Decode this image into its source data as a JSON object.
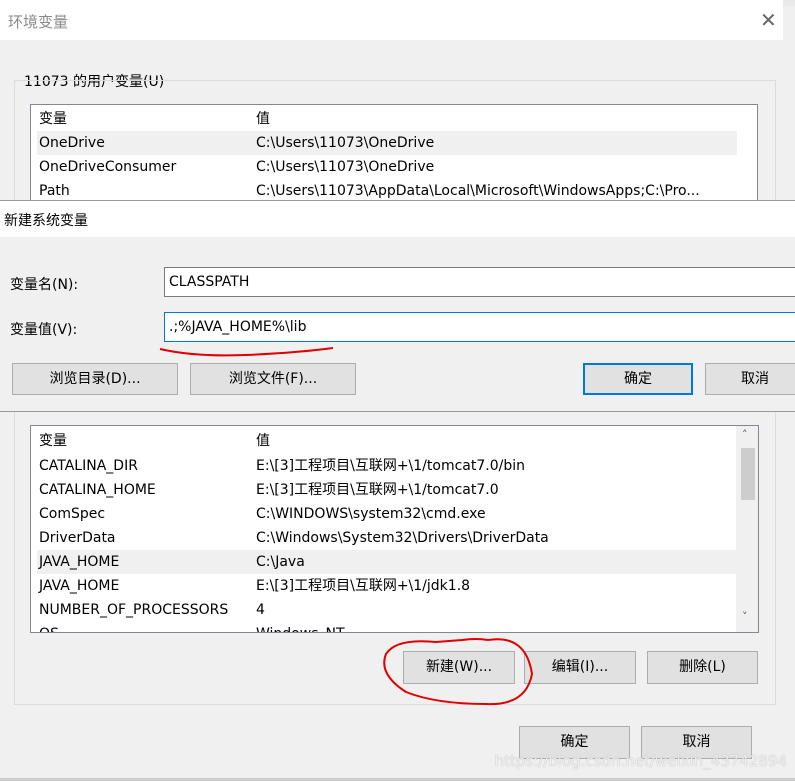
{
  "env_dialog": {
    "title": "环境变量",
    "close_icon": "close-icon",
    "user_group_label": "11073 的用户变量(U)",
    "user_columns": [
      "变量",
      "值"
    ],
    "user_rows": [
      [
        "OneDrive",
        "C:\\Users\\11073\\OneDrive"
      ],
      [
        "OneDriveConsumer",
        "C:\\Users\\11073\\OneDrive"
      ],
      [
        "Path",
        "C:\\Users\\11073\\AppData\\Local\\Microsoft\\WindowsApps;C:\\Pro..."
      ]
    ],
    "system_columns": [
      "变量",
      "值"
    ],
    "system_rows": [
      [
        "CATALINA_DIR",
        "E:\\[3]工程项目\\互联网+\\1/tomcat7.0/bin"
      ],
      [
        "CATALINA_HOME",
        "E:\\[3]工程项目\\互联网+\\1/tomcat7.0"
      ],
      [
        "ComSpec",
        "C:\\WINDOWS\\system32\\cmd.exe"
      ],
      [
        "DriverData",
        "C:\\Windows\\System32\\Drivers\\DriverData"
      ],
      [
        "JAVA_HOME",
        "C:\\Java"
      ],
      [
        "JAVA_HOME",
        "E:\\[3]工程项目\\互联网+\\1/jdk1.8"
      ],
      [
        "NUMBER_OF_PROCESSORS",
        "4"
      ],
      [
        "OS",
        "Windows_NT"
      ]
    ],
    "new_button": "新建(W)...",
    "edit_button": "编辑(I)...",
    "delete_button": "删除(L)",
    "ok_button": "确定",
    "cancel_button": "取消"
  },
  "new_var_dialog": {
    "title": "新建系统变量",
    "name_label": "变量名(N):",
    "name_value": "CLASSPATH",
    "value_label": "变量值(V):",
    "value_value": ".;%JAVA_HOME%\\lib",
    "browse_dir_button": "浏览目录(D)...",
    "browse_file_button": "浏览文件(F)...",
    "ok_button": "确定",
    "cancel_button": "取消"
  },
  "annotation_color": "#e00000",
  "watermark": "https://blog.csdn.net/weixin_43742894"
}
